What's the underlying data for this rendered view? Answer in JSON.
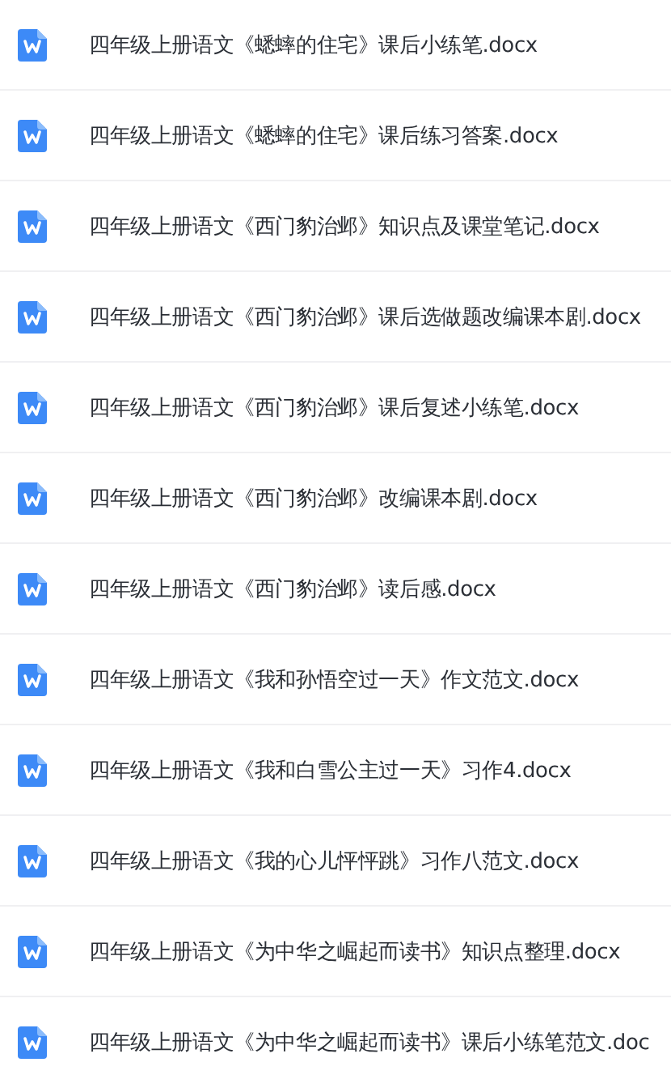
{
  "files": [
    {
      "name": "四年级上册语文《蟋蟀的住宅》课后小练笔.docx",
      "kind": "word"
    },
    {
      "name": "四年级上册语文《蟋蟀的住宅》课后练习答案.docx",
      "kind": "word"
    },
    {
      "name": "四年级上册语文《西门豹治邺》知识点及课堂笔记.docx",
      "kind": "word"
    },
    {
      "name": "四年级上册语文《西门豹治邺》课后选做题改编课本剧.docx",
      "kind": "word"
    },
    {
      "name": "四年级上册语文《西门豹治邺》课后复述小练笔.docx",
      "kind": "word"
    },
    {
      "name": "四年级上册语文《西门豹治邺》改编课本剧.docx",
      "kind": "word"
    },
    {
      "name": "四年级上册语文《西门豹治邺》读后感.docx",
      "kind": "word"
    },
    {
      "name": "四年级上册语文《我和孙悟空过一天》作文范文.docx",
      "kind": "word"
    },
    {
      "name": "四年级上册语文《我和白雪公主过一天》习作4.docx",
      "kind": "word"
    },
    {
      "name": "四年级上册语文《我的心儿怦怦跳》习作八范文.docx",
      "kind": "word"
    },
    {
      "name": "四年级上册语文《为中华之崛起而读书》知识点整理.docx",
      "kind": "word"
    },
    {
      "name": "四年级上册语文《为中华之崛起而读书》课后小练笔范文.doc",
      "kind": "word"
    }
  ]
}
